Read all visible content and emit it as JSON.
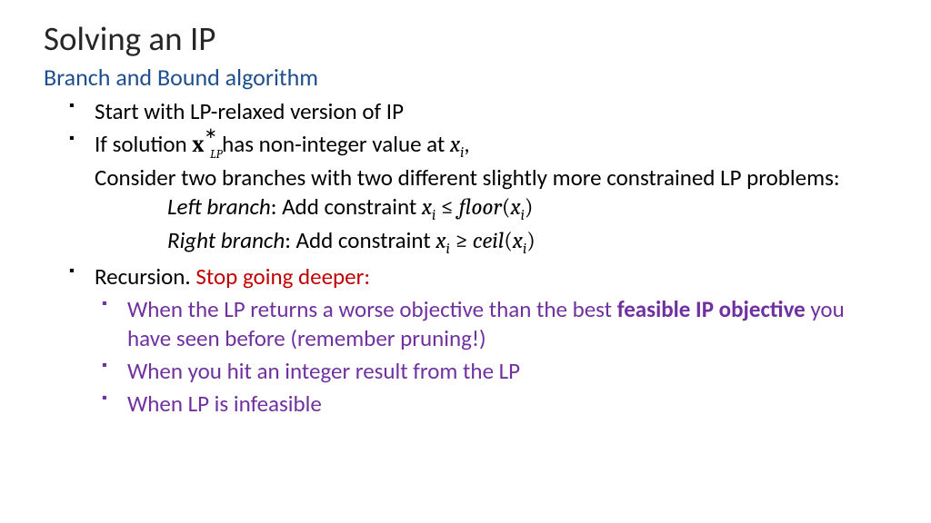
{
  "title": "Solving an IP",
  "subtitle": "Branch and Bound algorithm",
  "bullets": {
    "b1": "Start with LP-relaxed version of IP",
    "b2_pre": "If solution ",
    "b2_mid": " has non-integer value at ",
    "b2_post": ",",
    "b2_cont": "Consider two branches with two different slightly more constrained LP problems:",
    "left_label": "Left branch",
    "left_text": ": Add constraint ",
    "right_label": "Right branch",
    "right_text": ": Add constraint ",
    "b3_pre": "Recursion. ",
    "b3_red": "Stop going deeper:",
    "sub1_a": "When the LP returns a worse objective than the best ",
    "sub1_b": "feasible IP objective",
    "sub1_c": " you have seen before (remember pruning!)",
    "sub2": "When you hit an integer result from the LP",
    "sub3": "When LP is infeasible"
  },
  "math": {
    "x_bold": "x",
    "star": "∗",
    "lp_sub": "LP",
    "xi_x": "x",
    "xi_i": "i",
    "le": "≤",
    "ge": "≥",
    "floor": "floor",
    "ceil": "ceil",
    "lparen": "(",
    "rparen": ")"
  }
}
